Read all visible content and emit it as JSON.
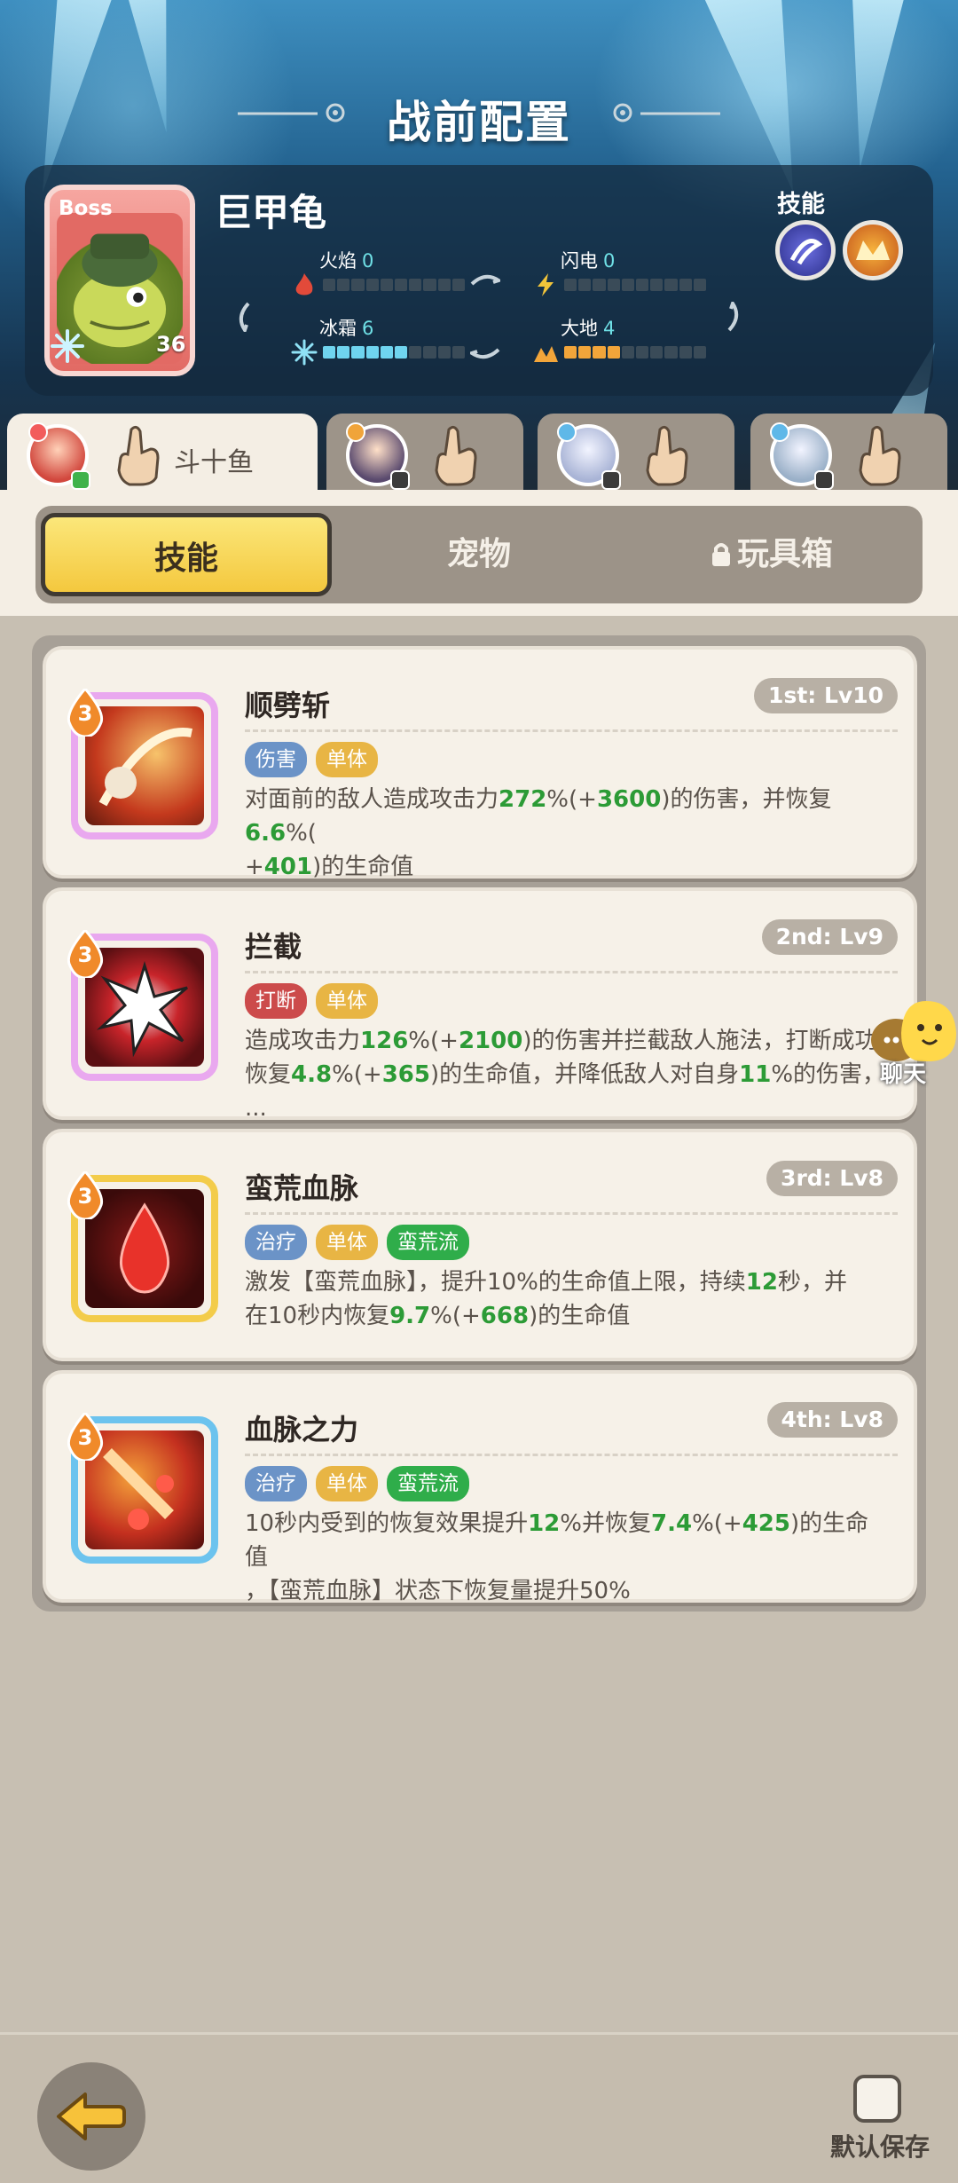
{
  "header": {
    "title": "战前配置"
  },
  "boss": {
    "tag": "Boss",
    "name": "巨甲龟",
    "level": "36",
    "skills_label": "技能",
    "stats": [
      {
        "label": "火焰",
        "value": "0",
        "level": 0,
        "max": 10,
        "color": "#e24a3a",
        "icon": "fire-icon"
      },
      {
        "label": "闪电",
        "value": "0",
        "level": 0,
        "max": 10,
        "color": "#f2c53a",
        "icon": "lightning-icon"
      },
      {
        "label": "冰霜",
        "value": "6",
        "level": 6,
        "max": 10,
        "color": "#6fd4ef",
        "icon": "snowflake-icon"
      },
      {
        "label": "大地",
        "value": "4",
        "level": 4,
        "max": 10,
        "color": "#f2a53a",
        "icon": "earth-icon"
      }
    ]
  },
  "characters": [
    {
      "name": "斗十鱼",
      "active": true
    },
    {
      "name": "",
      "active": false
    },
    {
      "name": "",
      "active": false
    },
    {
      "name": "",
      "active": false
    }
  ],
  "section_tabs": [
    "技能",
    "宠物",
    "玩具箱"
  ],
  "skills": [
    {
      "level": "3",
      "name": "顺劈斩",
      "rank": "1st: Lv10",
      "tags": [
        {
          "text": "伤害",
          "color": "blue"
        },
        {
          "text": "单体",
          "color": "gold"
        }
      ],
      "desc": [
        {
          "t": "对面前的敌人造成攻击力"
        },
        {
          "t": "272",
          "g": true
        },
        {
          "t": "%(+"
        },
        {
          "t": "3600",
          "g": true
        },
        {
          "t": ")的伤害，并恢复"
        },
        {
          "t": "6.6",
          "g": true
        },
        {
          "t": "%(\n+"
        },
        {
          "t": "401",
          "g": true
        },
        {
          "t": ")的生命值"
        }
      ]
    },
    {
      "level": "3",
      "name": "拦截",
      "rank": "2nd: Lv9",
      "tags": [
        {
          "text": "打断",
          "color": "red"
        },
        {
          "text": "单体",
          "color": "gold"
        }
      ],
      "desc": [
        {
          "t": "造成攻击力"
        },
        {
          "t": "126",
          "g": true
        },
        {
          "t": "%(+"
        },
        {
          "t": "2100",
          "g": true
        },
        {
          "t": ")的伤害并拦截敌人施法，打断成功\n恢复"
        },
        {
          "t": "4.8",
          "g": true
        },
        {
          "t": "%(+"
        },
        {
          "t": "365",
          "g": true
        },
        {
          "t": ")的生命值，并降低敌人对自身"
        },
        {
          "t": "11",
          "g": true
        },
        {
          "t": "%的伤害，\n..."
        }
      ]
    },
    {
      "level": "3",
      "name": "蛮荒血脉",
      "rank": "3rd: Lv8",
      "tags": [
        {
          "text": "治疗",
          "color": "blue"
        },
        {
          "text": "单体",
          "color": "gold"
        },
        {
          "text": "蛮荒流",
          "color": "green"
        }
      ],
      "desc": [
        {
          "t": "激发【蛮荒血脉】，提升10%的生命值上限，持续"
        },
        {
          "t": "12",
          "g": true
        },
        {
          "t": "秒，并\n在10秒内恢复"
        },
        {
          "t": "9.7",
          "g": true
        },
        {
          "t": "%(+"
        },
        {
          "t": "668",
          "g": true
        },
        {
          "t": ")的生命值"
        }
      ]
    },
    {
      "level": "3",
      "name": "血脉之力",
      "rank": "4th: Lv8",
      "tags": [
        {
          "text": "治疗",
          "color": "blue"
        },
        {
          "text": "单体",
          "color": "gold"
        },
        {
          "text": "蛮荒流",
          "color": "green"
        }
      ],
      "desc": [
        {
          "t": "10秒内受到的恢复效果提升"
        },
        {
          "t": "12",
          "g": true
        },
        {
          "t": "%并恢复"
        },
        {
          "t": "7.4",
          "g": true
        },
        {
          "t": "%(+"
        },
        {
          "t": "425",
          "g": true
        },
        {
          "t": ")的生命值\n，【蛮荒血脉】状态下恢复量提升50%"
        }
      ]
    }
  ],
  "chat": {
    "label": "聊天"
  },
  "footer": {
    "save_label": "默认保存"
  }
}
